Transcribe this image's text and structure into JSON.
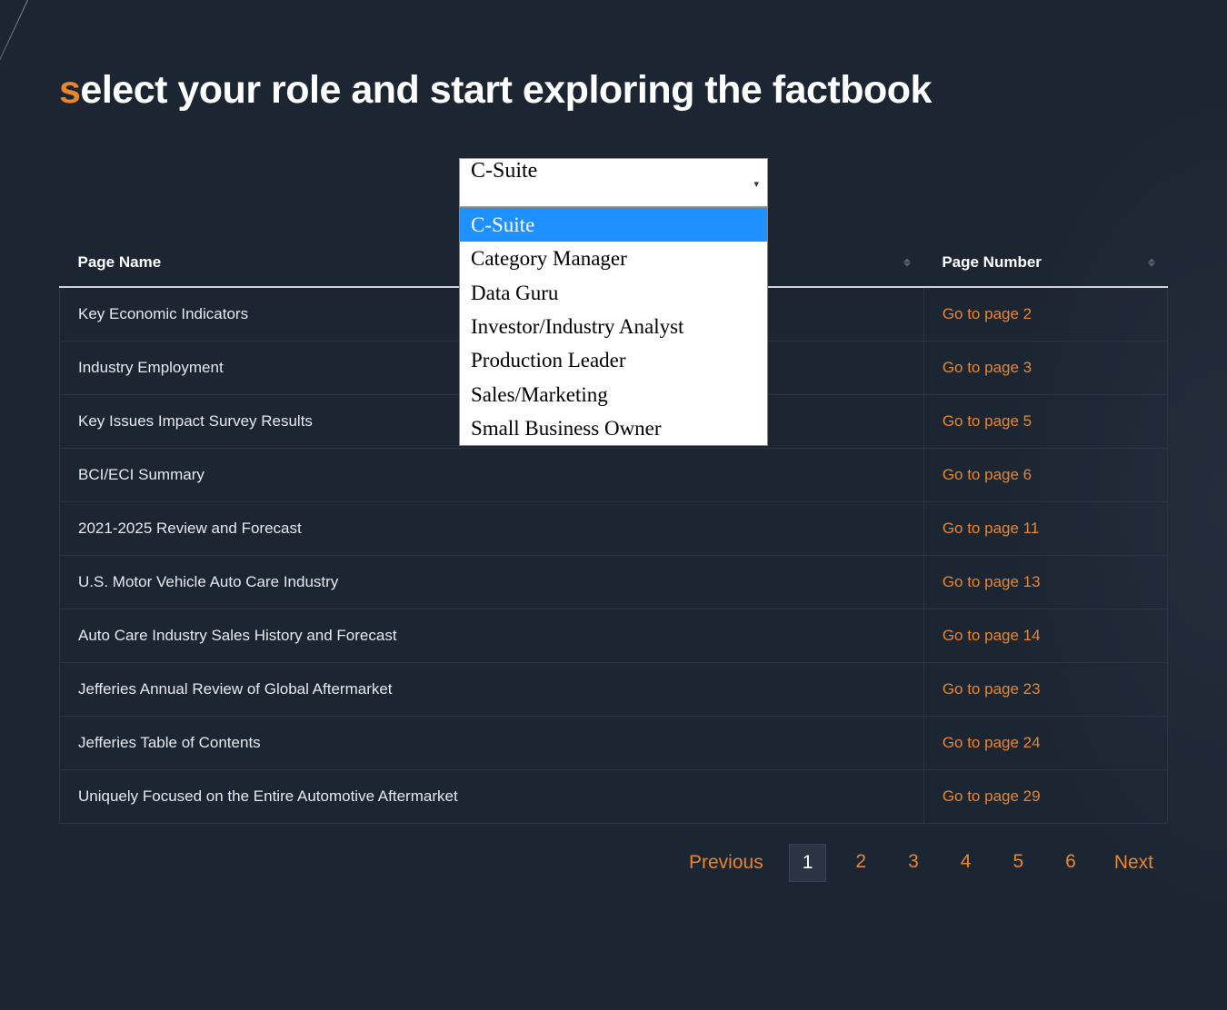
{
  "heading": {
    "accent_letter": "s",
    "rest": "elect your role and start exploring the factbook"
  },
  "role_select": {
    "selected": "C-Suite",
    "options": [
      "C-Suite",
      "Category Manager",
      "Data Guru",
      "Investor/Industry Analyst",
      "Production Leader",
      "Sales/Marketing",
      "Small Business Owner"
    ]
  },
  "table": {
    "headers": {
      "name": "Page Name",
      "link": "Page Number"
    },
    "rows": [
      {
        "name": "Key Economic Indicators",
        "link": "Go to page 2"
      },
      {
        "name": "Industry Employment",
        "link": "Go to page 3"
      },
      {
        "name": "Key Issues Impact Survey Results",
        "link": "Go to page 5"
      },
      {
        "name": "BCI/ECI Summary",
        "link": "Go to page 6"
      },
      {
        "name": "2021-2025 Review and Forecast",
        "link": "Go to page 11"
      },
      {
        "name": "U.S. Motor Vehicle Auto Care Industry",
        "link": "Go to page 13"
      },
      {
        "name": "Auto Care Industry Sales History and Forecast",
        "link": "Go to page 14"
      },
      {
        "name": "Jefferies Annual Review of Global Aftermarket",
        "link": "Go to page 23"
      },
      {
        "name": "Jefferies Table of Contents",
        "link": "Go to page 24"
      },
      {
        "name": "Uniquely Focused on the Entire Automotive Aftermarket",
        "link": "Go to page 29"
      }
    ]
  },
  "pagination": {
    "previous": "Previous",
    "next": "Next",
    "pages": [
      "1",
      "2",
      "3",
      "4",
      "5",
      "6"
    ],
    "current": "1"
  }
}
